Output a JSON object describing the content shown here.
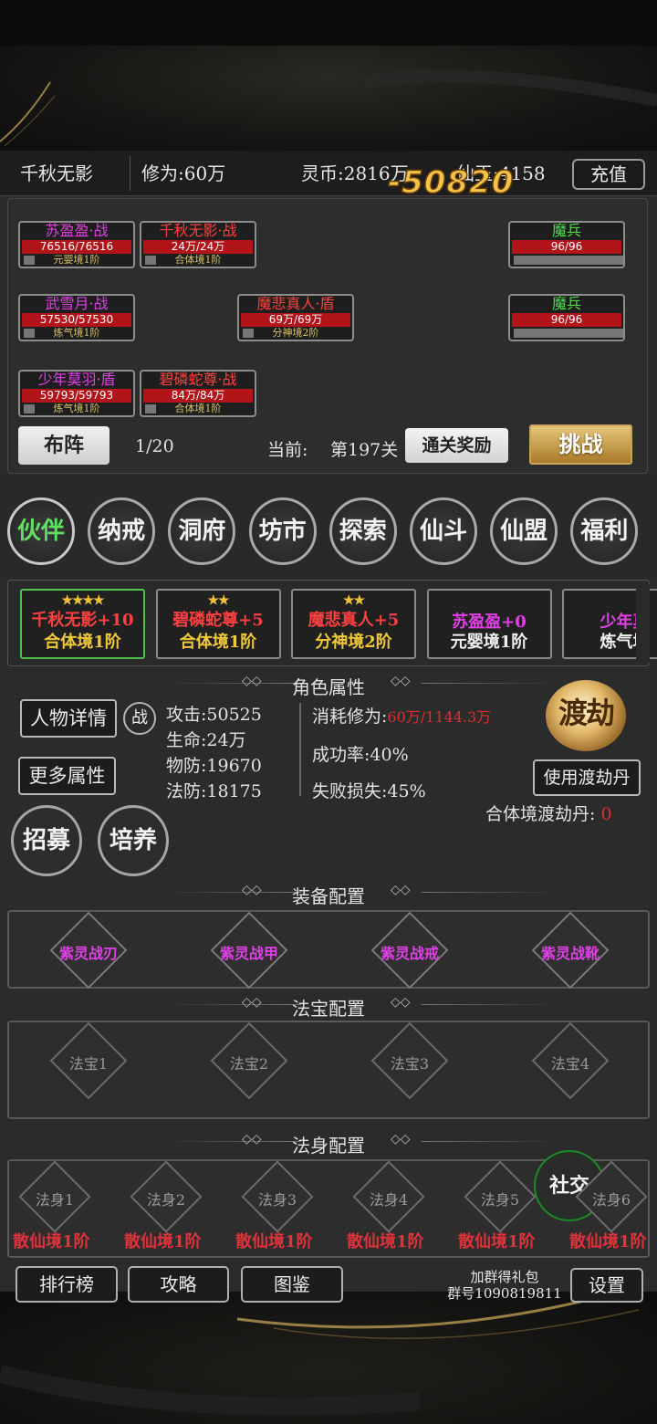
{
  "top_bar": {
    "player_name": "千秋无影",
    "cultivation": "修为:60万",
    "spirit_coin": "灵币:2816万",
    "immortal_jade": "仙玉:4158",
    "recharge_label": "充值"
  },
  "damage_popup": "-50820",
  "battle": {
    "allies": [
      {
        "name": "苏盈盈·战",
        "hp": "76516/76516",
        "rank": "元婴境1阶",
        "color": "#e040e6"
      },
      {
        "name": "千秋无影·战",
        "hp": "24万/24万",
        "rank": "合体境1阶",
        "color": "#ff4040"
      },
      {
        "name": "武雪月·战",
        "hp": "57530/57530",
        "rank": "炼气境1阶",
        "color": "#e040e6"
      },
      {
        "name": "魔悲真人·盾",
        "hp": "69万/69万",
        "rank": "分神境2阶",
        "color": "#ff4040"
      },
      {
        "name": "少年莫羽·盾",
        "hp": "59793/59793",
        "rank": "炼气境1阶",
        "color": "#e040e6"
      },
      {
        "name": "碧磷蛇尊·战",
        "hp": "84万/84万",
        "rank": "合体境1阶",
        "color": "#ff4040"
      }
    ],
    "enemies": [
      {
        "name": "魔兵",
        "hp": "96/96",
        "color": "#4ae04a"
      },
      {
        "name": "魔兵",
        "hp": "96/96",
        "color": "#4ae04a"
      }
    ],
    "formation_label": "布阵",
    "wave": "1/20",
    "current_label": "当前:",
    "stage": "第197关",
    "clear_reward_label": "通关奖励",
    "challenge_label": "挑战"
  },
  "tabs": [
    "伙伴",
    "纳戒",
    "洞府",
    "坊市",
    "探索",
    "仙斗",
    "仙盟",
    "福利"
  ],
  "partners": [
    {
      "stars": "★★★★",
      "name": "千秋无影+10",
      "rank": "合体境1阶",
      "color": "#ff4040"
    },
    {
      "stars": "★★",
      "name": "碧磷蛇尊+5",
      "rank": "合体境1阶",
      "color": "#ff4040"
    },
    {
      "stars": "★★",
      "name": "魔悲真人+5",
      "rank": "分神境2阶",
      "color": "#ff4040"
    },
    {
      "stars": "",
      "name": "苏盈盈+0",
      "rank": "元婴境1阶",
      "color": "#e040e6"
    },
    {
      "stars": "",
      "name": "少年莫",
      "rank": "炼气境",
      "color": "#e040e6"
    }
  ],
  "attributes": {
    "section_title": "角色属性",
    "detail_btn": "人物详情",
    "battle_icon": "战",
    "more_btn": "更多属性",
    "attack": "攻击:50525",
    "hp": "生命:24万",
    "phys_def": "物防:19670",
    "magic_def": "法防:18175",
    "cost_label": "消耗修为:",
    "cost_value": "60万/1144.3万",
    "success": "成功率:40%",
    "fail_loss": "失败损失:45%",
    "tribulation_badge": "渡劫",
    "use_pill_btn": "使用渡劫丹",
    "pill_label": "合体境渡劫丹:",
    "pill_count": "0",
    "recruit_btn": "招募",
    "train_btn": "培养"
  },
  "equipment": {
    "section_title": "装备配置",
    "slots": [
      "紫灵战刃",
      "紫灵战甲",
      "紫灵战戒",
      "紫灵战靴"
    ]
  },
  "treasure": {
    "section_title": "法宝配置",
    "slots": [
      "法宝1",
      "法宝2",
      "法宝3",
      "法宝4"
    ]
  },
  "dharma_body": {
    "section_title": "法身配置",
    "slots": [
      "法身1",
      "法身2",
      "法身3",
      "法身4",
      "法身5",
      "法身6"
    ],
    "ranks": [
      "散仙境1阶",
      "散仙境1阶",
      "散仙境1阶",
      "散仙境1阶",
      "散仙境1阶",
      "散仙境1阶"
    ],
    "social_btn": "社交"
  },
  "bottom": {
    "ranking": "排行榜",
    "guide": "攻略",
    "codex": "图鉴",
    "group_line1": "加群得礼包",
    "group_line2": "群号1090819811",
    "settings": "设置"
  }
}
